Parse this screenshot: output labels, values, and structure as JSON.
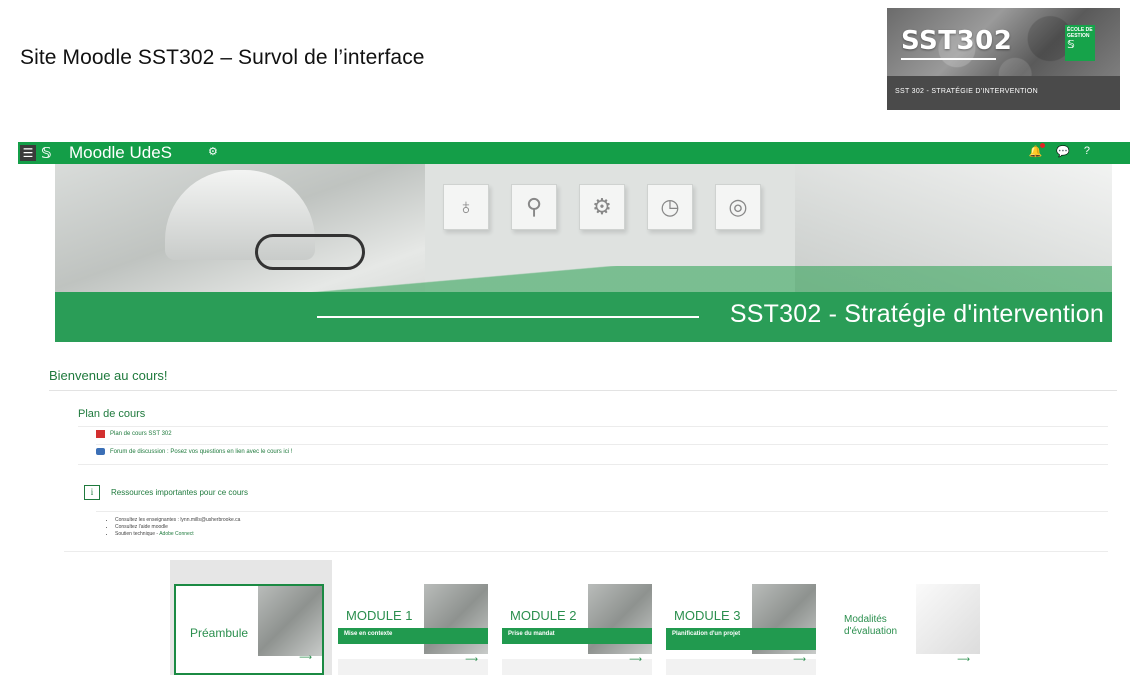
{
  "slide": {
    "title": "Site Moodle SST302 – Survol de l’interface",
    "thumb": {
      "code": "SST302",
      "subtitle": "SST 302 - STRATÉGIE D'INTERVENTION",
      "school": "ÉCOLE DE GESTION",
      "school_logo": "𝕊"
    }
  },
  "navbar": {
    "menu_icon": "☰",
    "logo": "𝕊",
    "site_name": "Moodle UdeS",
    "tool_icon": "⚙",
    "bell_icon": "🔔",
    "chat_icon": "💬",
    "help_icon": "?"
  },
  "banner": {
    "title": "SST302 - Stratégie d'intervention",
    "cubes": [
      "lightbulb-icon",
      "search-icon",
      "gears-icon",
      "clock-icon",
      "target-icon"
    ]
  },
  "course": {
    "welcome": "Bienvenue au cours!",
    "plan_title": "Plan de cours",
    "plan_pdf": "Plan de cours SST 302",
    "forum": "Forum de discussion : Posez vos questions en lien avec le cours ici !",
    "resources_title": "Ressources importantes pour ce cours",
    "resources": [
      "Consultez les enseignantes : lynn.mills@usherbrooke.ca",
      "Consultez l'aide moodle",
      "Soutien technique - "
    ],
    "resources_link": "Adobe Connect"
  },
  "tiles": [
    {
      "label": "Préambule",
      "sub": ""
    },
    {
      "label": "MODULE 1",
      "sub": "Mise en contexte"
    },
    {
      "label": "MODULE 2",
      "sub": "Prise du mandat"
    },
    {
      "label": "MODULE 3",
      "sub": "Planification d'un projet"
    },
    {
      "label": "Modalités d'évaluation",
      "sub": ""
    }
  ],
  "colors": {
    "accent_green": "#149e48",
    "banner_green": "#2a9d57",
    "text_green": "#1f7a3d"
  }
}
